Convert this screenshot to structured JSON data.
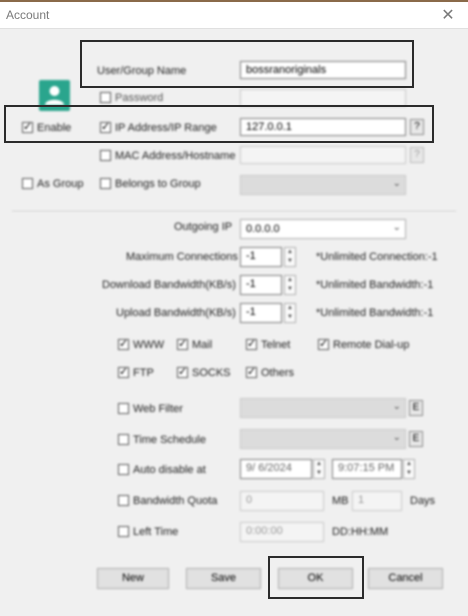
{
  "window": {
    "title": "Account",
    "close_glyph": "✕"
  },
  "header": {
    "user_group_name_label": "User/Group Name",
    "user_group_name_value": "bossranoriginals"
  },
  "auth": {
    "password_label": "Password",
    "enable_label": "Enable",
    "ip_range_label": "IP Address/IP Range",
    "ip_value": "127.0.0.1",
    "mac_label": "MAC Address/Hostname",
    "as_group_label": "As Group",
    "belongs_label": "Belongs to Group",
    "help_glyph": "?"
  },
  "settings": {
    "outgoing_ip_label": "Outgoing IP",
    "outgoing_ip_value": "0.0.0.0",
    "max_conn_label": "Maximum Connections",
    "max_conn_value": "-1",
    "max_conn_hint": "*Unlimited Connection:-1",
    "download_label": "Download Bandwidth(KB/s)",
    "download_value": "-1",
    "download_hint": "*Unlimited Bandwidth:-1",
    "upload_label": "Upload Bandwidth(KB/s)",
    "upload_value": "-1",
    "upload_hint": "*Unlimited Bandwidth:-1"
  },
  "services": [
    "WWW",
    "Mail",
    "Telnet",
    "Remote Dial-up",
    "FTP",
    "SOCKS",
    "Others"
  ],
  "filters": {
    "web_filter_label": "Web Filter",
    "time_schedule_label": "Time Schedule",
    "edit_glyph": "E",
    "auto_disable_label": "Auto disable at",
    "auto_disable_date": "9/ 6/2024",
    "auto_disable_time": "9:07:15 PM",
    "quota_label": "Bandwidth Quota",
    "quota_value": "0",
    "quota_unit": "MB",
    "quota_days_value": "1",
    "quota_days_label": "Days",
    "left_time_label": "Left Time",
    "left_time_value": "0:00:00",
    "left_time_format": "DD:HH:MM"
  },
  "buttons": {
    "new": "New",
    "save": "Save",
    "ok": "OK",
    "cancel": "Cancel"
  },
  "colors": {
    "icon_bg": "#2aa58d",
    "highlight": "#2b2b2b"
  }
}
